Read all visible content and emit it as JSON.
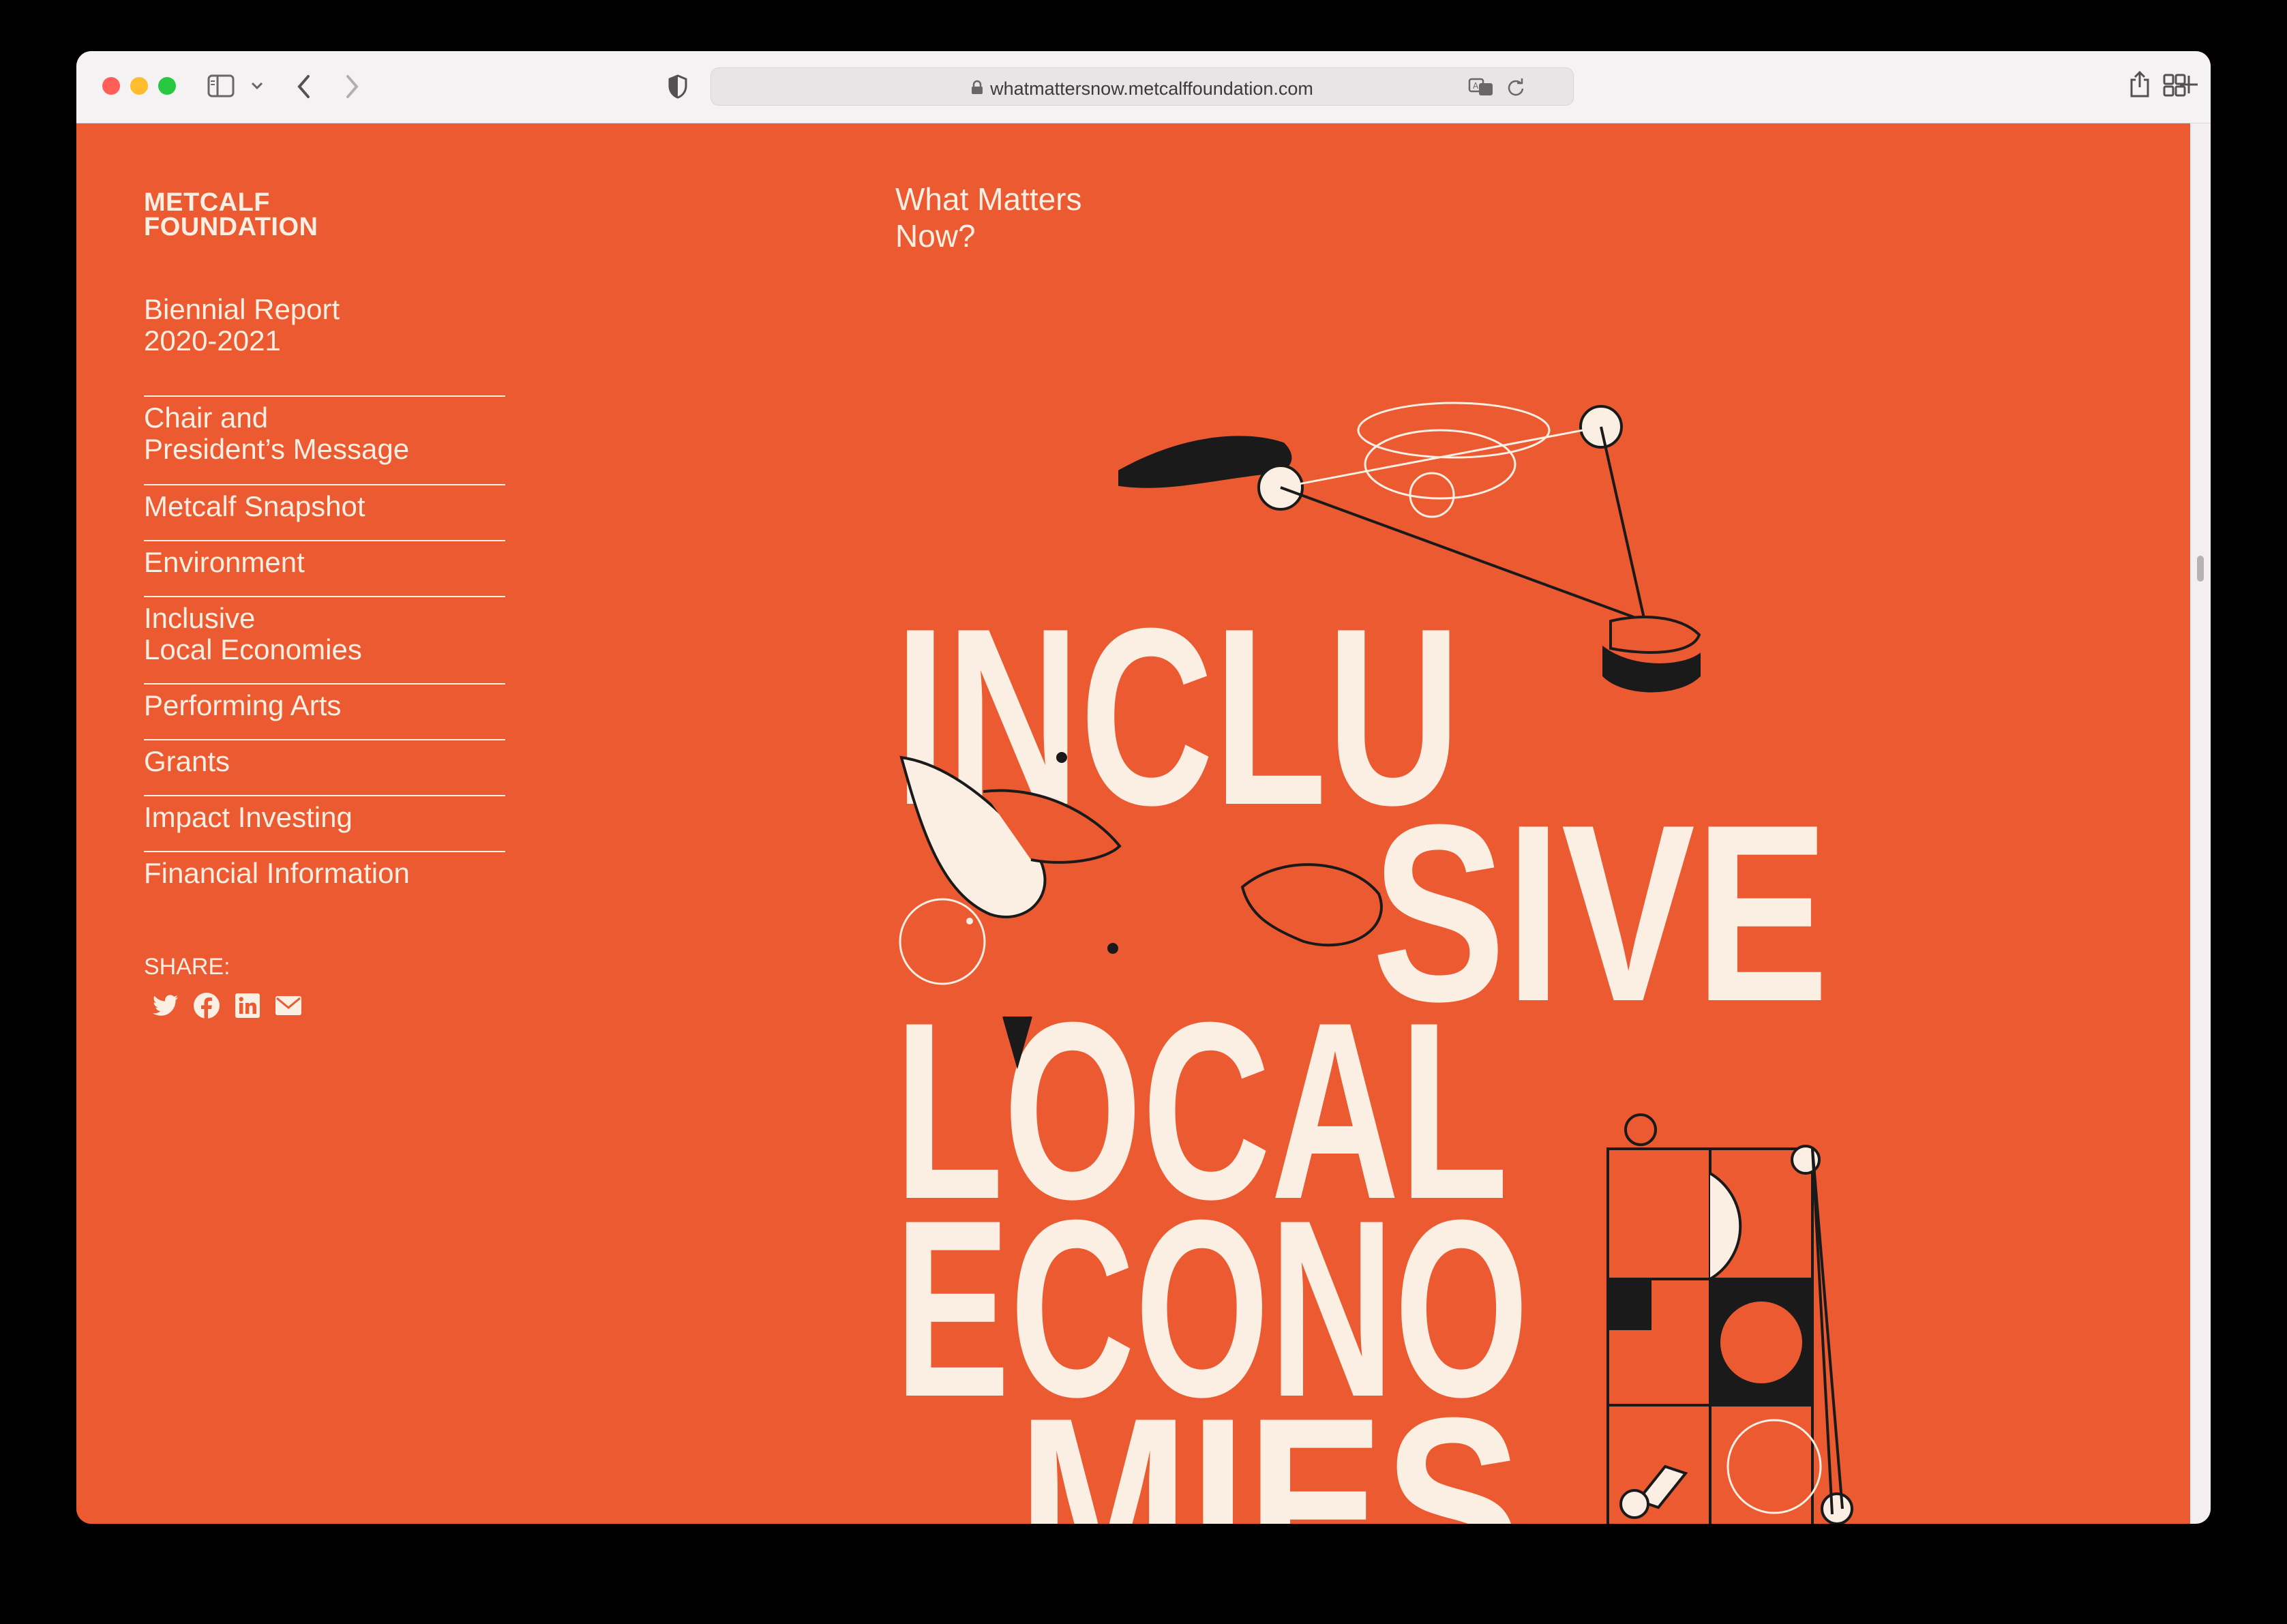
{
  "browser": {
    "url": "whatmattersnow.metcalffoundation.com",
    "traffic_lights": {
      "close": "#ff5f57",
      "minimize": "#febc2e",
      "zoom": "#28c840"
    }
  },
  "site": {
    "logo_line1": "METCALF",
    "logo_line2": "FOUNDATION",
    "report_line1": "Biennial Report",
    "report_line2": "2020-2021",
    "nav": [
      {
        "label": "Chair and\nPresident’s Message"
      },
      {
        "label": "Metcalf Snapshot"
      },
      {
        "label": "Environment"
      },
      {
        "label": "Inclusive\nLocal Economies"
      },
      {
        "label": "Performing Arts"
      },
      {
        "label": "Grants"
      },
      {
        "label": "Impact Investing"
      },
      {
        "label": "Financial Information"
      }
    ],
    "share_label": "SHARE:",
    "share_icons": [
      "twitter-icon",
      "facebook-icon",
      "linkedin-icon",
      "email-icon"
    ],
    "headline_line1": "What Matters",
    "headline_line2": "Now?"
  },
  "artwork": {
    "line1": "INCLU",
    "line2": "SIVE",
    "line3": "LOCAL",
    "line4": "ECONO",
    "line5": "MIES"
  },
  "colors": {
    "page_background": "#eb5a30",
    "text_cream": "#fbefe4",
    "ink": "#1a1a1a"
  }
}
